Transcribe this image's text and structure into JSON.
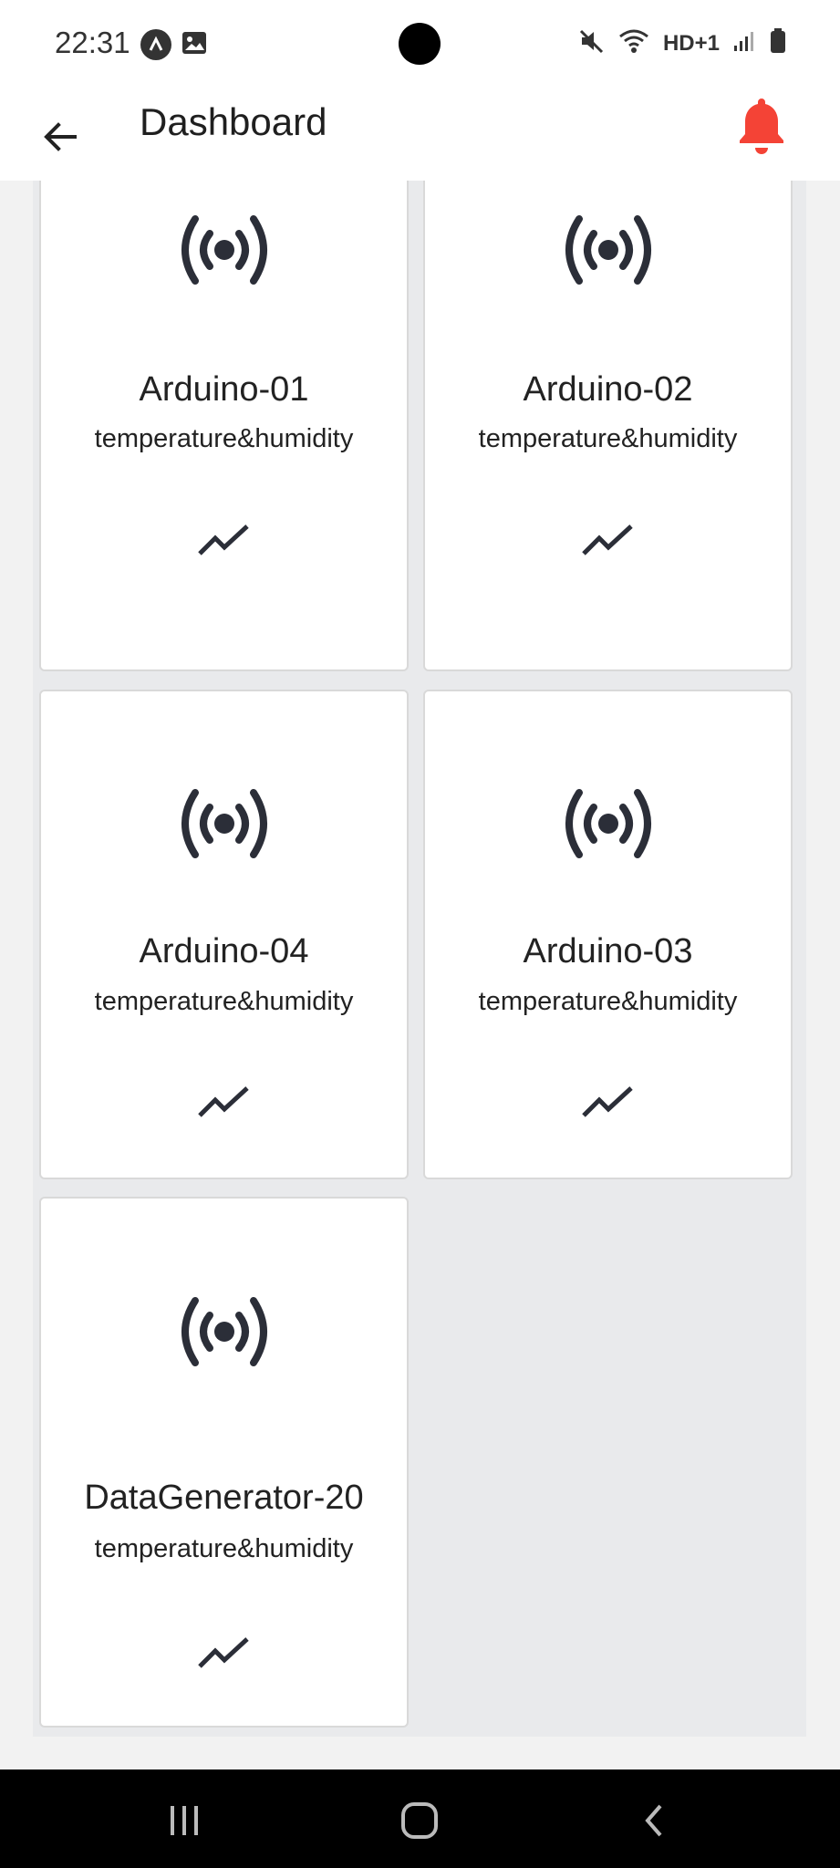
{
  "status_bar": {
    "time": "22:31",
    "left_icons": [
      "app-notification-icon",
      "image-icon"
    ],
    "right_icons": [
      "mute-icon",
      "wifi-icon",
      "hd-icon",
      "signal-icon",
      "battery-icon"
    ],
    "hd_label": "HD+1"
  },
  "app_bar": {
    "title": "Dashboard",
    "back_icon": "arrow-left-icon",
    "bell_icon": "bell-icon",
    "bell_color": "#f44336"
  },
  "devices": [
    {
      "name": "Arduino-01",
      "type": "temperature&humidity"
    },
    {
      "name": "Arduino-02",
      "type": "temperature&humidity"
    },
    {
      "name": "Arduino-04",
      "type": "temperature&humidity"
    },
    {
      "name": "Arduino-03",
      "type": "temperature&humidity"
    },
    {
      "name": "DataGenerator-20",
      "type": "temperature&humidity"
    }
  ],
  "nav_bar": {
    "items": [
      "recent-apps-icon",
      "home-icon",
      "back-icon"
    ]
  }
}
